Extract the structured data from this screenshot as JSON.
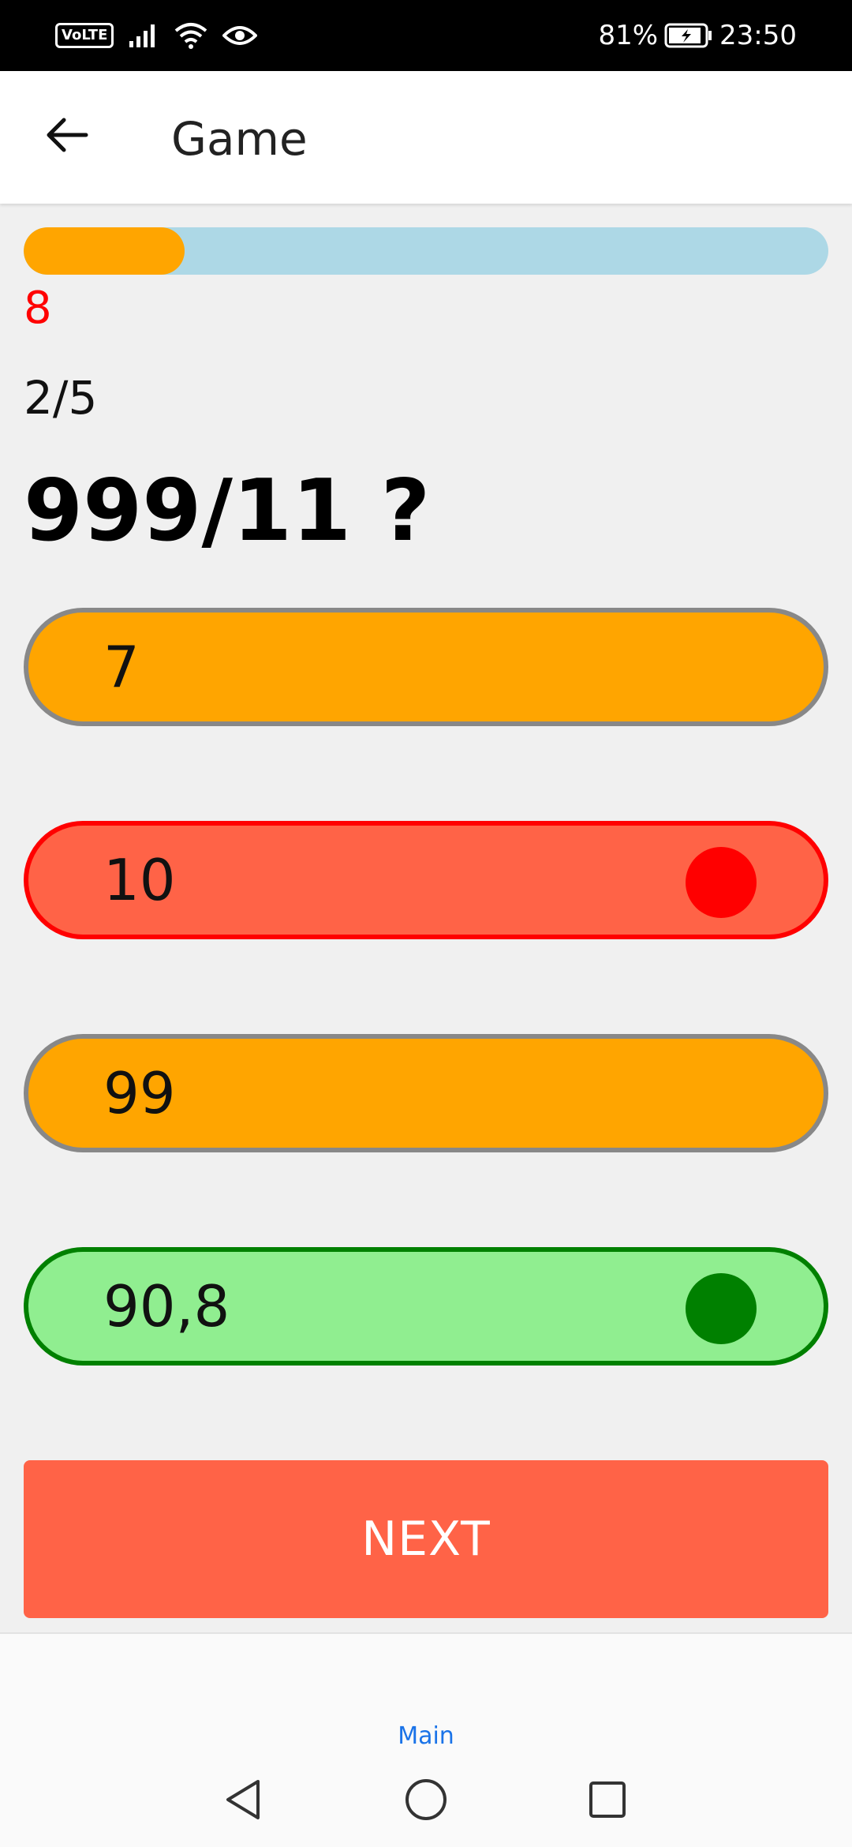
{
  "status_bar": {
    "volte": "VoLTE",
    "battery": "81%",
    "time": "23:50"
  },
  "app_bar": {
    "title": "Game"
  },
  "game": {
    "progress_fraction": 0.2,
    "score": "8",
    "counter": "2/5",
    "question": "999/11 ?",
    "answers": [
      {
        "label": "7",
        "state": "neutral"
      },
      {
        "label": "10",
        "state": "wrong"
      },
      {
        "label": "99",
        "state": "neutral"
      },
      {
        "label": "90,8",
        "state": "correct"
      }
    ],
    "next_label": "NEXT"
  },
  "bottom_nav": {
    "tab_label": "Main"
  },
  "colors": {
    "accent_orange": "#ffa500",
    "wrong": "#ff6347",
    "correct": "#90ee90",
    "progress_track": "#add8e6"
  }
}
